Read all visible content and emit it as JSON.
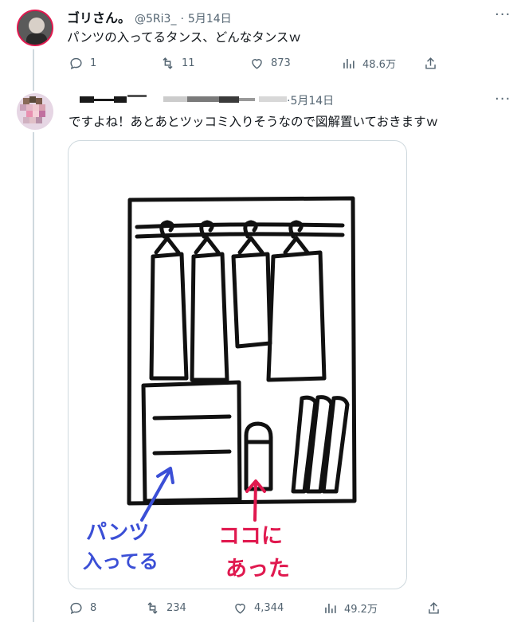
{
  "tweet1": {
    "name": "ゴリさん。",
    "handle": "@5Ri3_",
    "sep": "·",
    "date": "5月14日",
    "text": "パンツの入ってるタンス、どんなタンスｗ",
    "more": "···",
    "actions": {
      "replies": "1",
      "retweets": "11",
      "likes": "873",
      "views": "48.6万"
    }
  },
  "tweet2": {
    "date": "·5月14日",
    "text": "ですよね！あとあとツッコミ入りそうなので図解置いておきますｗ",
    "more": "···",
    "image": {
      "label_blue_1": "パンツ",
      "label_blue_2": "入ってる",
      "label_red_1": "ココに",
      "label_red_2": "あった"
    },
    "actions": {
      "replies": "8",
      "retweets": "234",
      "likes": "4,344",
      "views": "49.2万"
    }
  },
  "colors": {
    "text": "#0f1419",
    "muted": "#536471",
    "blue_ink": "#3b4fd6",
    "red_ink": "#e0194f"
  }
}
